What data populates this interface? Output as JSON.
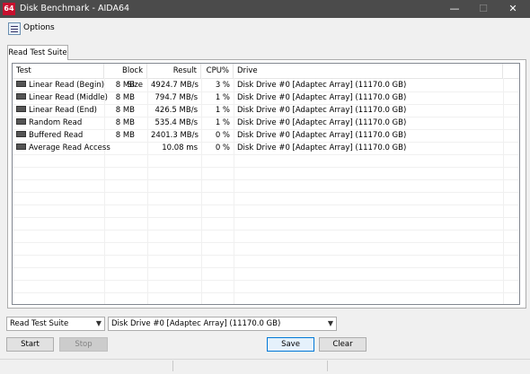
{
  "window": {
    "title": "Disk Benchmark - AIDA64",
    "app_icon_label": "64"
  },
  "window_controls": {
    "minimize": "—",
    "maximize": "☐",
    "close": "✕"
  },
  "toolbar": {
    "options_label": "Options"
  },
  "tab": {
    "label": "Read Test Suite"
  },
  "table": {
    "columns": [
      "Test",
      "Block Size",
      "Result",
      "CPU%",
      "Drive"
    ],
    "rows": [
      {
        "test": "Linear Read (Begin)",
        "block": "8 MB",
        "result": "4924.7 MB/s",
        "cpu": "3 %",
        "drive": "Disk Drive #0  [Adaptec Array]  (11170.0 GB)"
      },
      {
        "test": "Linear Read (Middle)",
        "block": "8 MB",
        "result": "794.7 MB/s",
        "cpu": "1 %",
        "drive": "Disk Drive #0  [Adaptec Array]  (11170.0 GB)"
      },
      {
        "test": "Linear Read (End)",
        "block": "8 MB",
        "result": "426.5 MB/s",
        "cpu": "1 %",
        "drive": "Disk Drive #0  [Adaptec Array]  (11170.0 GB)"
      },
      {
        "test": "Random Read",
        "block": "8 MB",
        "result": "535.4 MB/s",
        "cpu": "1 %",
        "drive": "Disk Drive #0  [Adaptec Array]  (11170.0 GB)"
      },
      {
        "test": "Buffered Read",
        "block": "8 MB",
        "result": "2401.3 MB/s",
        "cpu": "0 %",
        "drive": "Disk Drive #0  [Adaptec Array]  (11170.0 GB)"
      },
      {
        "test": "Average Read Access",
        "block": "",
        "result": "10.08 ms",
        "cpu": "0 %",
        "drive": "Disk Drive #0  [Adaptec Array]  (11170.0 GB)"
      }
    ]
  },
  "controls": {
    "suite_select": "Read Test Suite",
    "drive_select": "Disk Drive #0  [Adaptec Array]  (11170.0 GB)",
    "start": "Start",
    "stop": "Stop",
    "save": "Save",
    "clear": "Clear"
  },
  "icons": {
    "options": "options-icon",
    "row": "drive-icon"
  }
}
